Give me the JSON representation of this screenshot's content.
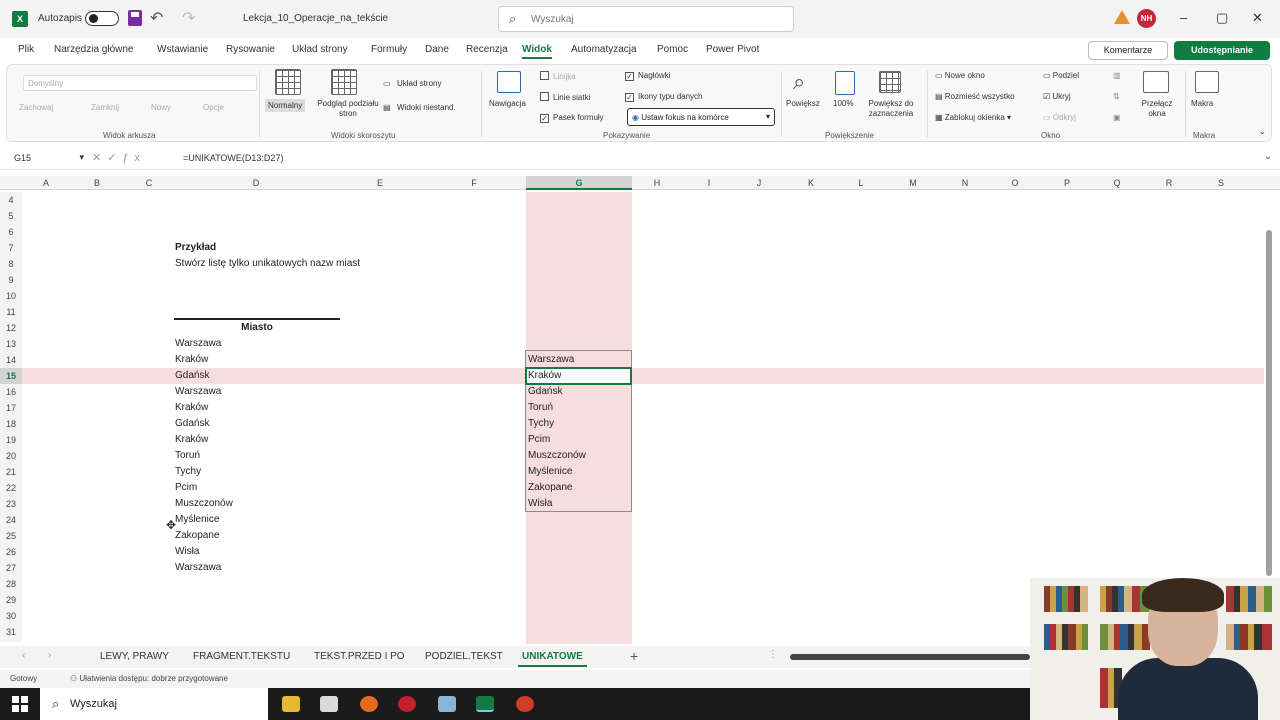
{
  "titlebar": {
    "app_logo": "X",
    "autosave_label": "Autozapis",
    "filename": "Lekcja_10_Operacje_na_tekście",
    "search_placeholder": "Wyszukaj",
    "user_initials": "NH",
    "minimize": "–",
    "restore": "▢",
    "close": "✕"
  },
  "ribbon_tabs": [
    "Plik",
    "Narzędzia główne",
    "Wstawianie",
    "Rysowanie",
    "Układ strony",
    "Formuły",
    "Dane",
    "Recenzja",
    "Widok",
    "Automatyzacja",
    "Pomoc",
    "Power Pivot"
  ],
  "active_tab": "Widok",
  "comments_label": "Komentarze",
  "share_label": "Udostępnianie",
  "ribbon": {
    "sheet_view": {
      "combo_value": "Domyślny",
      "keep": "Zachowaj",
      "close": "Zamknij",
      "new": "Nowy",
      "options": "Opcje",
      "group": "Widok arkusza"
    },
    "workbook_views": {
      "normal": "Normalny",
      "page_break": "Podgląd podziału stron",
      "page_layout": "Układ strony",
      "custom": "Widoki niestand.",
      "group": "Widoki skoroszytu"
    },
    "show": {
      "navigation": "Nawigacja",
      "ruler": "Linijka",
      "gridlines": "Linie siatki",
      "formula_bar": "Pasek formuły",
      "headings": "Nagłówki",
      "data_icons": "Ikony typu danych",
      "focus_cell": "Ustaw fokus na komórce",
      "group": "Pokazywanie"
    },
    "zoom": {
      "zoom": "Powiększ",
      "hundred": "100%",
      "to_selection": "Powiększ do zaznaczenia",
      "group": "Powiększenie"
    },
    "window": {
      "new_window": "Nowe okno",
      "arrange_all": "Rozmieść wszystko",
      "freeze": "Zablokuj okienka",
      "split": "Podziel",
      "hide": "Ukryj",
      "unhide": "Odkryj",
      "switch": "Przełącz okna",
      "group": "Okno"
    },
    "macros": {
      "macros": "Makra",
      "group": "Makra"
    }
  },
  "formula_bar": {
    "name_box": "G15",
    "formula": "=UNIKATOWE(D13:D27)"
  },
  "columns": [
    "A",
    "B",
    "C",
    "D",
    "E",
    "F",
    "G",
    "H",
    "I",
    "J",
    "K",
    "L",
    "M",
    "N",
    "O",
    "P",
    "Q",
    "R",
    "S"
  ],
  "rows": [
    "4",
    "5",
    "6",
    "7",
    "8",
    "9",
    "10",
    "11",
    "12",
    "13",
    "14",
    "15",
    "16",
    "17",
    "18",
    "19",
    "20",
    "21",
    "22",
    "23",
    "24",
    "25",
    "26",
    "27",
    "28",
    "29",
    "30",
    "31"
  ],
  "sheet": {
    "example_title": "Przykład",
    "example_desc": "Stwórz listę tylko unikatowych nazw miast",
    "column_header": "Miasto",
    "cities": [
      "Warszawa",
      "Kraków",
      "Gdańsk",
      "Warszawa",
      "Kraków",
      "Gdańsk",
      "Kraków",
      "Toruń",
      "Tychy",
      "Pcim",
      "Muszczonów",
      "Myślenice",
      "Zakopane",
      "Wisła",
      "Warszawa"
    ],
    "unique": [
      "Warszawa",
      "Kraków",
      "Gdańsk",
      "Toruń",
      "Tychy",
      "Pcim",
      "Muszczonów",
      "Myślenice",
      "Zakopane",
      "Wisła"
    ]
  },
  "sheet_tabs": [
    "LEWY, PRAWY",
    "FRAGMENT.TEKSTU",
    "TEKST.PRZED I PO",
    "PODZIEL.TEKST",
    "UNIKATOWE"
  ],
  "active_sheet": "UNIKATOWE",
  "status": {
    "ready": "Gotowy",
    "accessibility": "Ułatwienia dostępu: dobrze przygotowane"
  },
  "taskbar": {
    "search_placeholder": "Wyszukaj"
  },
  "colors": {
    "excel_green": "#107c41",
    "highlight_pink": "#f6dede"
  }
}
